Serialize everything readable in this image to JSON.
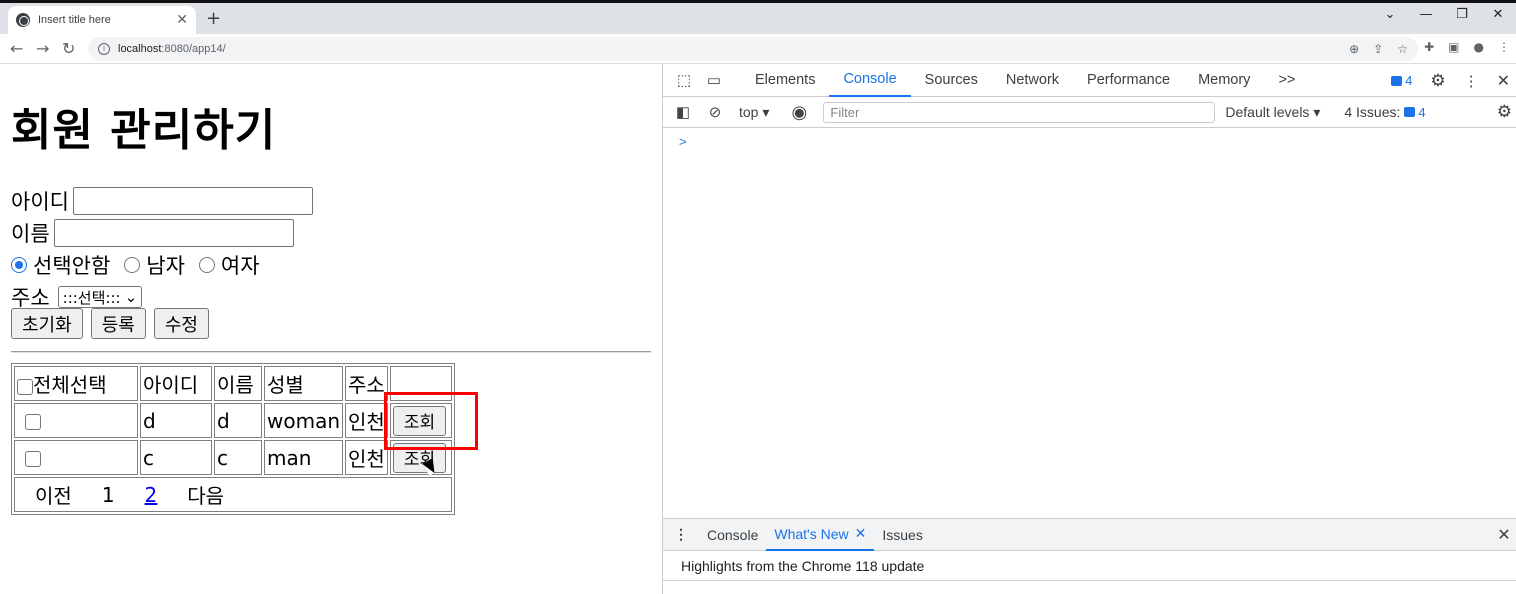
{
  "browser": {
    "tab_title": "Insert title here",
    "new_tab": "+",
    "url_host": "localhost",
    "url_rest": ":8080/app14/"
  },
  "page": {
    "heading": "회원 관리하기",
    "id_label": "아이디",
    "name_label": "이름",
    "gender_options": [
      "선택안함",
      "남자",
      "여자"
    ],
    "gender_selected": "선택안함",
    "address_label": "주소",
    "address_select": ":::선택:::",
    "buttons": {
      "reset": "초기화",
      "register": "등록",
      "update": "수정"
    },
    "table": {
      "headers": [
        "전체선택",
        "아이디",
        "이름",
        "성별",
        "주소",
        ""
      ],
      "rows": [
        {
          "id": "d",
          "name": "d",
          "gender": "woman",
          "address": "인천",
          "action": "조회"
        },
        {
          "id": "c",
          "name": "c",
          "gender": "man",
          "address": "인천",
          "action": "조회"
        }
      ],
      "pager": {
        "prev": "이전",
        "pages": [
          "1",
          "2"
        ],
        "current_page": "1",
        "next": "다음"
      }
    }
  },
  "devtools": {
    "tabs": [
      "Elements",
      "Console",
      "Sources",
      "Network",
      "Performance",
      "Memory"
    ],
    "active_tab": "Console",
    "more": ">>",
    "message_count": "4",
    "context": "top",
    "filter_placeholder": "Filter",
    "levels": "Default levels",
    "issues_label": "4 Issues:",
    "issues_count": "4",
    "prompt": ">",
    "drawer_tabs": [
      "Console",
      "What's New",
      "Issues"
    ],
    "drawer_active": "What's New",
    "whats_new_text": "Highlights from the Chrome 118 update"
  },
  "colors": {
    "highlight": "#ff0000",
    "devtools_accent": "#1a73e8",
    "link": "#0000ee"
  }
}
